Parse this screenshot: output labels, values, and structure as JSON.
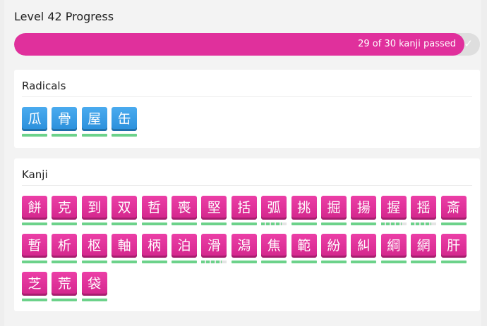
{
  "title": "Level 42 Progress",
  "progress": {
    "label": "29 of 30 kanji passed",
    "passed": 29,
    "total": 30,
    "fill_color": "#e0309c",
    "icon": "check-icon"
  },
  "radicals": {
    "heading": "Radicals",
    "color": "#3a9fe8",
    "items": [
      {
        "char": "瓜",
        "srs": 1
      },
      {
        "char": "骨",
        "srs": 1
      },
      {
        "char": "屋",
        "srs": 1
      },
      {
        "char": "缶",
        "srs": 1
      }
    ]
  },
  "kanji": {
    "heading": "Kanji",
    "color": "#e0309c",
    "items": [
      {
        "char": "餅",
        "srs": 1
      },
      {
        "char": "克",
        "srs": 1
      },
      {
        "char": "到",
        "srs": 1
      },
      {
        "char": "双",
        "srs": 1
      },
      {
        "char": "哲",
        "srs": 1
      },
      {
        "char": "喪",
        "srs": 1
      },
      {
        "char": "堅",
        "srs": 1
      },
      {
        "char": "括",
        "srs": 1
      },
      {
        "char": "弧",
        "srs": 0.8
      },
      {
        "char": "挑",
        "srs": 1
      },
      {
        "char": "掘",
        "srs": 1
      },
      {
        "char": "揚",
        "srs": 1
      },
      {
        "char": "握",
        "srs": 0.8
      },
      {
        "char": "揺",
        "srs": 0.8
      },
      {
        "char": "斎",
        "srs": 1
      },
      {
        "char": "暫",
        "srs": 1
      },
      {
        "char": "析",
        "srs": 1
      },
      {
        "char": "枢",
        "srs": 1
      },
      {
        "char": "軸",
        "srs": 1
      },
      {
        "char": "柄",
        "srs": 1
      },
      {
        "char": "泊",
        "srs": 1
      },
      {
        "char": "滑",
        "srs": 0.8
      },
      {
        "char": "潟",
        "srs": 1
      },
      {
        "char": "焦",
        "srs": 1
      },
      {
        "char": "範",
        "srs": 1
      },
      {
        "char": "紛",
        "srs": 1
      },
      {
        "char": "糾",
        "srs": 1
      },
      {
        "char": "綱",
        "srs": 1
      },
      {
        "char": "網",
        "srs": 1
      },
      {
        "char": "肝",
        "srs": 1
      },
      {
        "char": "芝",
        "srs": 1
      },
      {
        "char": "荒",
        "srs": 1
      },
      {
        "char": "袋",
        "srs": 1
      }
    ]
  }
}
